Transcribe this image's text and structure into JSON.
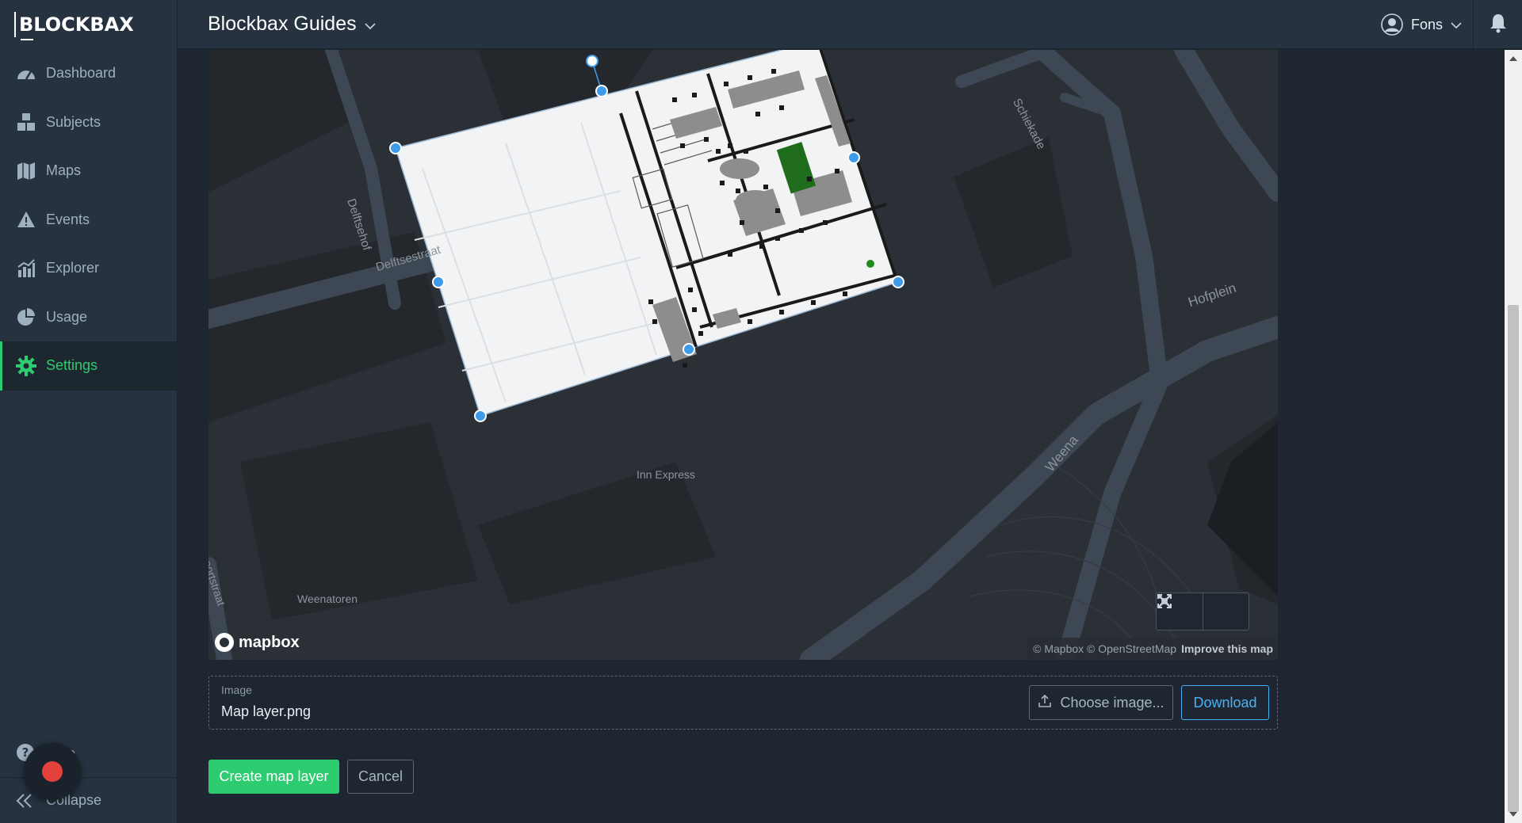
{
  "brand": {
    "name": "BLOCKBAX"
  },
  "sidebar": {
    "items": [
      {
        "label": "Dashboard",
        "icon": "gauge-icon"
      },
      {
        "label": "Subjects",
        "icon": "blocks-icon"
      },
      {
        "label": "Maps",
        "icon": "map-icon"
      },
      {
        "label": "Events",
        "icon": "warning-icon"
      },
      {
        "label": "Explorer",
        "icon": "chart-icon"
      },
      {
        "label": "Usage",
        "icon": "pie-icon"
      },
      {
        "label": "Settings",
        "icon": "gear-icon",
        "active": true
      }
    ],
    "help_label": "Help",
    "collapse_label": "Collapse"
  },
  "header": {
    "title": "Blockbax Guides",
    "user_name": "Fons"
  },
  "map": {
    "street_labels": {
      "delftsehof": "Delftsehof",
      "delftsestraat": "Delftsestraat",
      "schiekade": "Schiekade",
      "hofplein": "Hofplein",
      "weena": "Weena",
      "weenatoren": "Weenatoren",
      "poortstraat": "oortstraat",
      "inn_express": "Inn Express"
    },
    "logo": "mapbox",
    "attribution": "© Mapbox © OpenStreetMap",
    "improve_link": "Improve this map"
  },
  "image_field": {
    "label": "Image",
    "value": "Map layer.png",
    "choose_label": "Choose image...",
    "download_label": "Download"
  },
  "actions": {
    "create_label": "Create map layer",
    "cancel_label": "Cancel"
  },
  "colors": {
    "accent_green": "#2ecc71",
    "accent_blue": "#4ab0f5",
    "record_red": "#e2413c"
  }
}
